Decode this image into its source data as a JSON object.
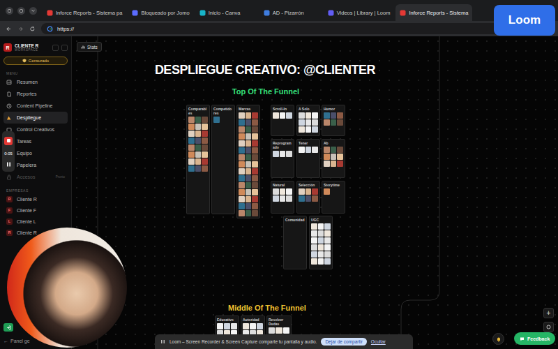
{
  "browser": {
    "tabs": [
      {
        "label": "Inforce Reports - Sistema pa",
        "selected": false
      },
      {
        "label": "Bloqueado por Jomo",
        "selected": false
      },
      {
        "label": "Inicio - Canva",
        "selected": false
      },
      {
        "label": "AD - Pizarrón",
        "selected": false
      },
      {
        "label": "Videos | Library | Loom",
        "selected": false
      },
      {
        "label": "Inforce Reports - Sistema",
        "selected": true
      }
    ],
    "url": "https://"
  },
  "loom_badge": "Loom",
  "sidebar": {
    "logo": "R",
    "workspace": "CLIENTE R",
    "workspace_sub": "WORKSPACE",
    "badge": "Censurado",
    "menu_label": "MENU",
    "items": [
      {
        "label": "Resumen",
        "selected": false,
        "disabled": false
      },
      {
        "label": "Reportes",
        "selected": false,
        "disabled": false
      },
      {
        "label": "Content Pipeline",
        "selected": false,
        "disabled": false
      },
      {
        "label": "Despliegue",
        "selected": true,
        "disabled": false
      },
      {
        "label": "Control Creativos",
        "selected": false,
        "disabled": false
      },
      {
        "label": "Tareas",
        "selected": false,
        "disabled": false
      },
      {
        "label": "Equipo",
        "selected": false,
        "disabled": false
      },
      {
        "label": "Papelera",
        "selected": false,
        "disabled": false
      },
      {
        "label": "Accesos",
        "selected": false,
        "disabled": true,
        "tag": "Pronto"
      }
    ],
    "companies_label": "EMPRESAS",
    "companies": [
      {
        "initial": "R",
        "label": "Cliente R"
      },
      {
        "initial": "F",
        "label": "Cliente F"
      },
      {
        "initial": "L",
        "label": "Cliente L"
      },
      {
        "initial": "R",
        "label": "Cliente R"
      }
    ],
    "footer": {
      "icon": "←",
      "label": "Panel ge"
    }
  },
  "recorder": {
    "time": "0:05"
  },
  "toolbar": {
    "stats": "Stats"
  },
  "board": {
    "title": "DESPLIEGUE CREATIVO: @CLIENTER",
    "funnels": [
      {
        "title": "Top Of The Funnel",
        "color": "#35e07a",
        "cards": [
          {
            "title": "Comparables",
            "thumbnails": 24,
            "kind": "photo"
          },
          {
            "title": "Competidores",
            "thumbnails": 1,
            "kind": "photo"
          },
          {
            "title": "Marcas",
            "thumbnails": 45,
            "kind": "photo"
          },
          {
            "title": "Scroll-In",
            "thumbnails": 3,
            "kind": "light"
          },
          {
            "title": "A Solo",
            "thumbnails": 9,
            "kind": "light"
          },
          {
            "title": "Humor",
            "thumbnails": 6,
            "kind": "photo"
          },
          {
            "title": "Reprogramado",
            "thumbnails": 3,
            "kind": "light"
          },
          {
            "title": "Tener",
            "thumbnails": 3,
            "kind": "light"
          },
          {
            "title": "Ab",
            "thumbnails": 9,
            "kind": "photo"
          },
          {
            "title": "Natural",
            "thumbnails": 6,
            "kind": "light"
          },
          {
            "title": "Selección",
            "thumbnails": 6,
            "kind": "photo"
          },
          {
            "title": "Storytime",
            "thumbnails": 1,
            "kind": "photo"
          },
          {
            "title": "Comunidad",
            "thumbnails": 0,
            "kind": "light"
          },
          {
            "title": "UGC",
            "thumbnails": 18,
            "kind": "light"
          }
        ]
      },
      {
        "title": "Middle Of The Funnel",
        "color": "#f2c230",
        "cards": [
          {
            "title": "Educativo",
            "thumbnails": 6,
            "kind": "light"
          },
          {
            "title": "Autoridad",
            "thumbnails": 6,
            "kind": "light"
          },
          {
            "title": "Resolver Dudas",
            "thumbnails": 6,
            "kind": "light"
          }
        ]
      }
    ]
  },
  "share_bar": {
    "message": "Loom – Screen Recorder & Screen Capture comparte tu pantalla y audio.",
    "stop": "Dejar de compartir",
    "hide": "Ocultar"
  },
  "feedback": "Feedback",
  "zoom": {
    "in": "+"
  }
}
